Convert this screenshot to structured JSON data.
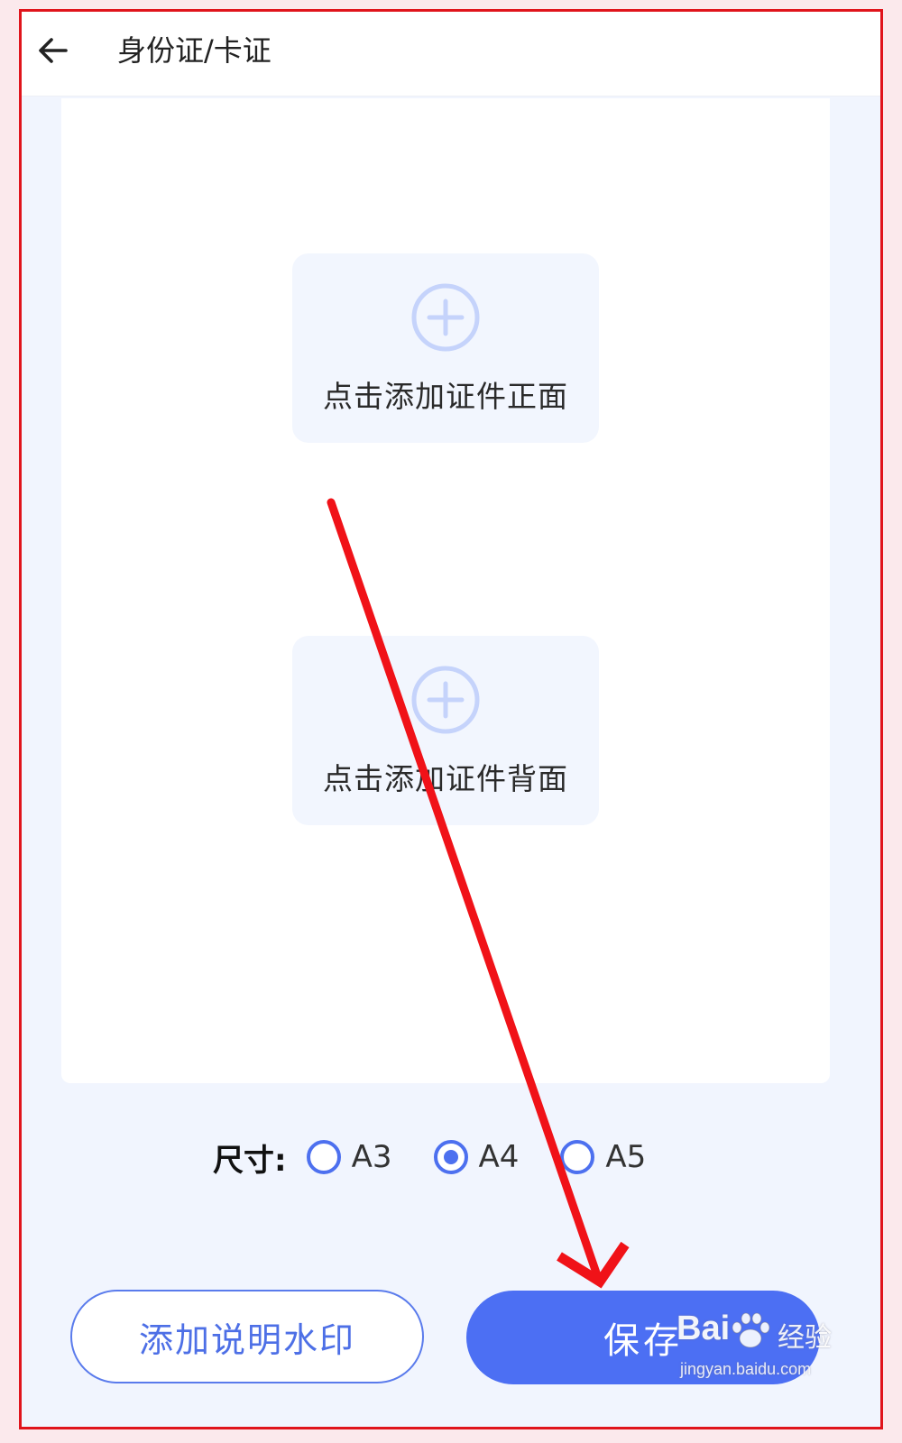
{
  "header": {
    "title": "身份证/卡证",
    "back_icon": "arrow-left-icon"
  },
  "upload": {
    "front_label": "点击添加证件正面",
    "back_label": "点击添加证件背面",
    "icon": "plus-circle-icon"
  },
  "size": {
    "label": "尺寸:",
    "options": [
      {
        "label": "A3",
        "checked": false
      },
      {
        "label": "A4",
        "checked": true
      },
      {
        "label": "A5",
        "checked": false
      }
    ]
  },
  "actions": {
    "watermark_label": "添加说明水印",
    "save_label": "保存"
  },
  "colors": {
    "accent": "#4c6ff3",
    "annotation": "#e0141c",
    "background": "#f1f5fe"
  },
  "watermark": {
    "brand": "Bai",
    "brand2": "经验",
    "url": "jingyan.baidu.com"
  }
}
